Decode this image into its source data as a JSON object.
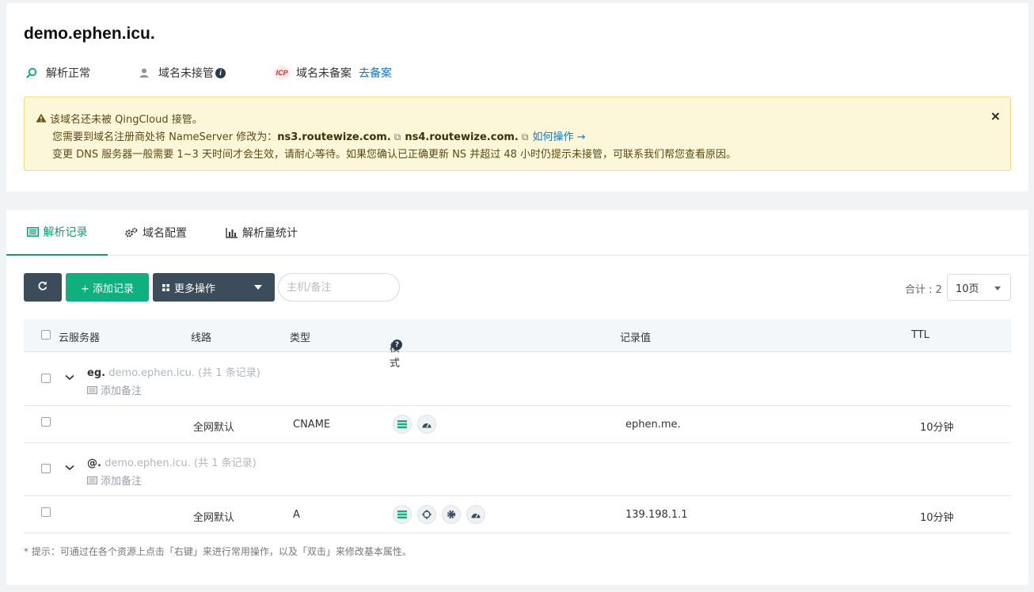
{
  "header": {
    "domain": "demo.ephen.icu.",
    "status_resolve": "解析正常",
    "status_managed": "域名未接管",
    "icp_badge": "ICP",
    "status_icp": "域名未备案",
    "icp_link": "去备案"
  },
  "alert": {
    "line1": "该域名还未被 QingCloud 接管。",
    "line2_prefix": "您需要到域名注册商处将 NameServer 修改为：",
    "ns1": "ns3.routewize.com.",
    "ns2": "ns4.routewize.com.",
    "how_link": "如何操作 →",
    "line3": "变更 DNS 服务器一般需要 1~3 天时间才会生效，请耐心等待。如果您确认已正确更新 NS 并超过 48 小时仍提示未接管，可联系我们帮您查看原因。",
    "close": "×"
  },
  "tabs": [
    {
      "label": "解析记录",
      "icon": "list-icon",
      "active": true
    },
    {
      "label": "域名配置",
      "icon": "gears-icon",
      "active": false
    },
    {
      "label": "解析量统计",
      "icon": "bar-chart-icon",
      "active": false
    }
  ],
  "toolbar": {
    "add_label": "+ 添加记录",
    "more_label": "更多操作",
    "search_placeholder": "主机/备注",
    "total_label": "合计 : 2",
    "page_size": "10页"
  },
  "table": {
    "headers": {
      "server": "云服务器",
      "line": "线路",
      "type": "类型",
      "mode": "模式",
      "value": "记录值",
      "ttl": "TTL"
    },
    "groups": [
      {
        "host": "eg.",
        "domain": "demo.ephen.icu.",
        "count": "(共 1 条记录)",
        "note": "添加备注",
        "record": {
          "line": "全网默认",
          "type": "CNAME",
          "value": "ephen.me.",
          "ttl": "10分钟",
          "mode_icons": [
            "record-mode-icon",
            "dashboard-icon"
          ]
        }
      },
      {
        "host": "@.",
        "domain": "demo.ephen.icu.",
        "count": "(共 1 条记录)",
        "note": "添加备注",
        "record": {
          "line": "全网默认",
          "type": "A",
          "value": "139.198.1.1",
          "ttl": "10分钟",
          "mode_icons": [
            "record-mode-icon",
            "target-icon",
            "gear-icon",
            "dashboard-icon"
          ]
        }
      }
    ]
  },
  "hint": "* 提示：可通过在各个资源上点击「右键」来进行常用操作，以及「双击」来修改基本属性。",
  "colors": {
    "primary_green": "#10b07e",
    "dark_button": "#3b4c5a",
    "link_blue": "#1676c2",
    "alert_bg": "#fdf7da"
  }
}
